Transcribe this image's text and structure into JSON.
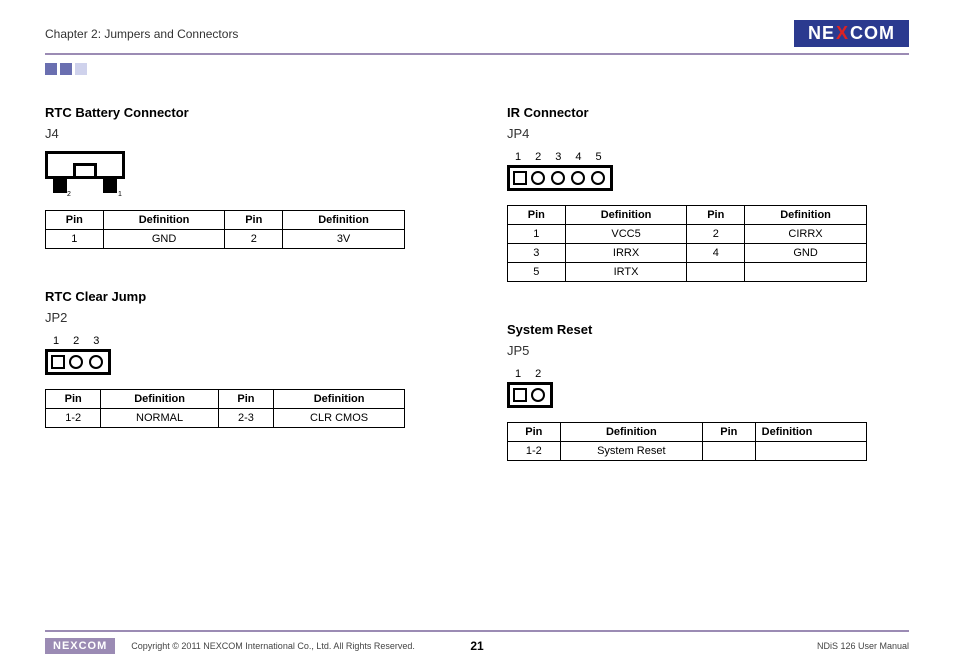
{
  "header": {
    "chapter": "Chapter 2: Jumpers and Connectors",
    "logo": {
      "pre": "NE",
      "x": "X",
      "post": "COM"
    }
  },
  "sections": {
    "rtc_battery": {
      "title": "RTC Battery Connector",
      "sub": "J4",
      "headers": [
        "Pin",
        "Definition",
        "Pin",
        "Definition"
      ],
      "rows": [
        [
          "1",
          "GND",
          "2",
          "3V"
        ]
      ],
      "label2": "2",
      "label1": "1"
    },
    "rtc_clear": {
      "title": "RTC Clear Jump",
      "sub": "JP2",
      "pins": [
        "1",
        "2",
        "3"
      ],
      "headers": [
        "Pin",
        "Definition",
        "Pin",
        "Definition"
      ],
      "rows": [
        [
          "1-2",
          "NORMAL",
          "2-3",
          "CLR CMOS"
        ]
      ]
    },
    "ir": {
      "title": "IR Connector",
      "sub": "JP4",
      "pins": [
        "1",
        "2",
        "3",
        "4",
        "5"
      ],
      "headers": [
        "Pin",
        "Definition",
        "Pin",
        "Definition"
      ],
      "rows": [
        [
          "1",
          "VCC5",
          "2",
          "CIRRX"
        ],
        [
          "3",
          "IRRX",
          "4",
          "GND"
        ],
        [
          "5",
          "IRTX",
          "",
          ""
        ]
      ]
    },
    "reset": {
      "title": "System Reset",
      "sub": "JP5",
      "pins": [
        "1",
        "2"
      ],
      "headers": [
        "Pin",
        "Definition",
        "Pin",
        "Definition"
      ],
      "rows": [
        [
          "1-2",
          "System Reset",
          "",
          ""
        ]
      ]
    }
  },
  "footer": {
    "logo": "NEXCOM",
    "copyright": "Copyright © 2011 NEXCOM International Co., Ltd. All Rights Reserved.",
    "page": "21",
    "doc": "NDiS 126 User Manual"
  }
}
